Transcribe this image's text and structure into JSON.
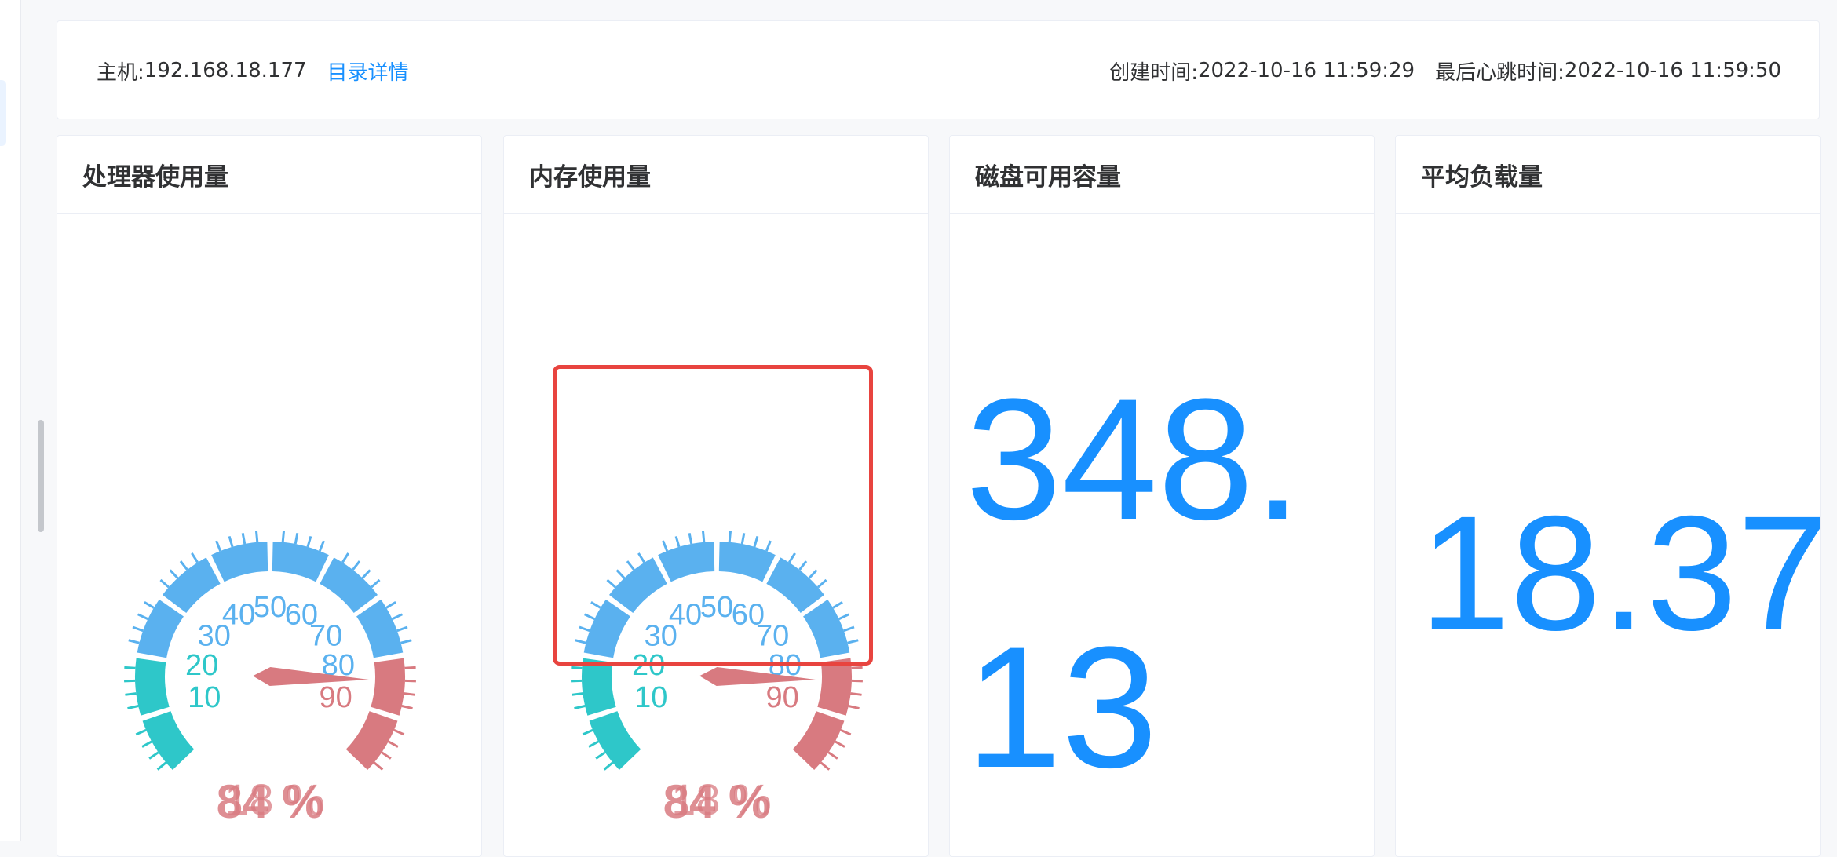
{
  "header": {
    "host_label": "主机: ",
    "host_value": "192.168.18.177",
    "detail_link": "目录详情",
    "created_label": "创建时间: ",
    "created_value": "2022-10-16 11:59:29",
    "heartbeat_label": "最后心跳时间: ",
    "heartbeat_value": "2022-10-16 11:59:50"
  },
  "panels": [
    {
      "title": "处理器使用量",
      "gauge": {
        "value": 84,
        "percent_label": "84 %",
        "overlay_label": "18 %"
      }
    },
    {
      "title": "内存使用量",
      "gauge": {
        "value": 84,
        "percent_label": "84 %",
        "overlay_label": "18 %"
      }
    },
    {
      "title": "磁盘可用容量",
      "value": "348.13"
    },
    {
      "title": "平均负载量",
      "value": "18.37"
    }
  ],
  "gauge_scale": {
    "min": 0,
    "max": 100,
    "tick_labels": [
      "10",
      "20",
      "30",
      "40",
      "50",
      "60",
      "70",
      "80",
      "90"
    ],
    "bands": [
      {
        "to": 20,
        "color": "#2ec7c9"
      },
      {
        "to": 80,
        "color": "#5ab1ef"
      },
      {
        "to": 100,
        "color": "#d87a80"
      }
    ]
  },
  "colors": {
    "accent": "#1890ff",
    "highlight_border": "#e8443f"
  }
}
